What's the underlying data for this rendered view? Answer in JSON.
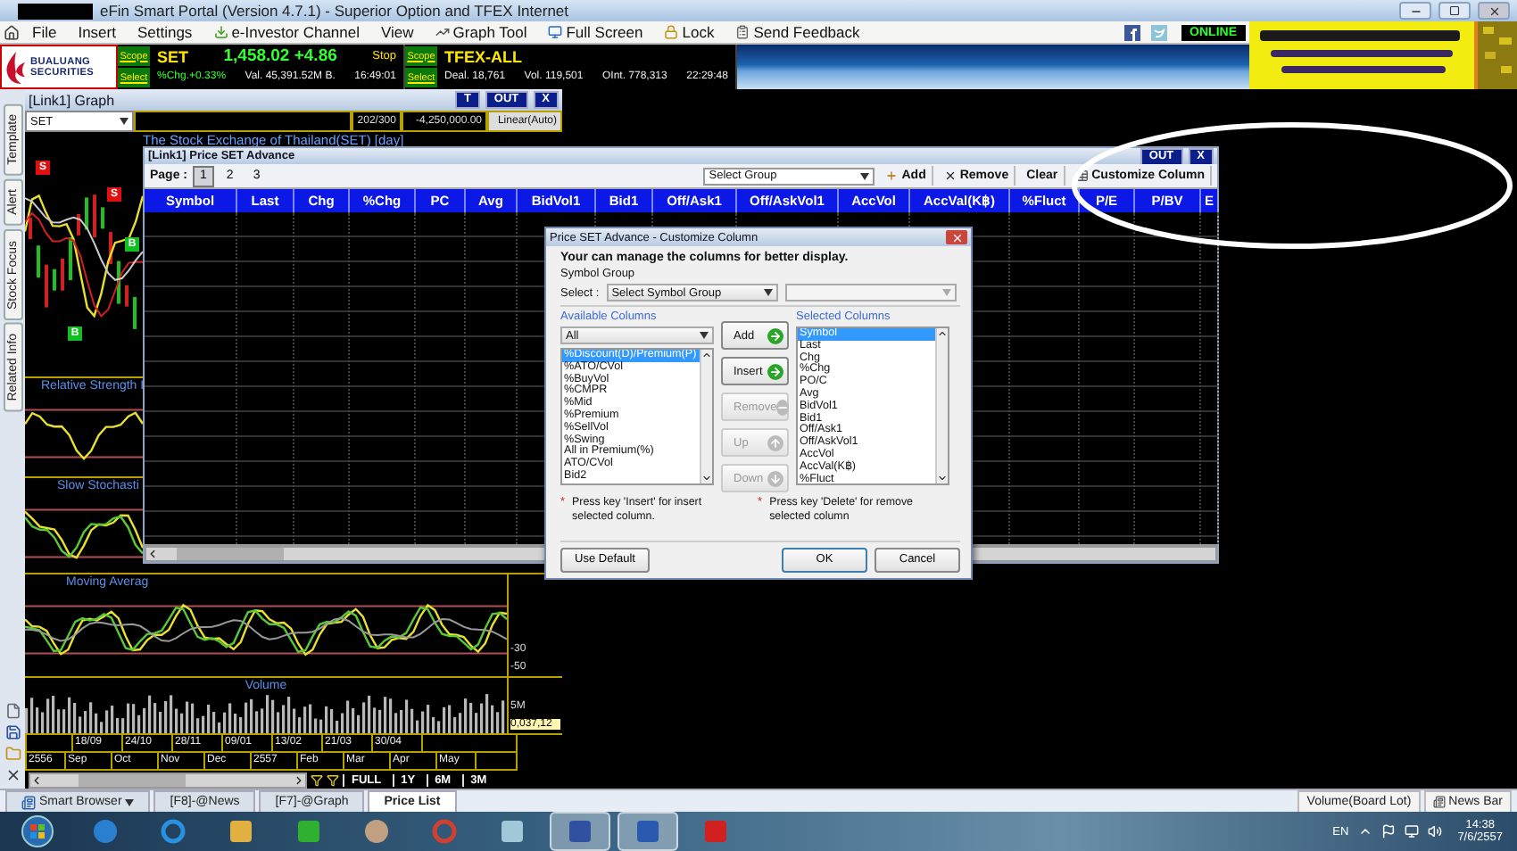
{
  "window": {
    "title": "eFin Smart Portal (Version 4.7.1) - Superior Option and TFEX Internet"
  },
  "menu": [
    {
      "label": "File",
      "kind": "text"
    },
    {
      "label": "Insert",
      "kind": "text"
    },
    {
      "label": "Settings",
      "kind": "text"
    },
    {
      "label": "e-Investor Channel",
      "kind": "channel"
    },
    {
      "label": "View",
      "kind": "text"
    },
    {
      "label": "Graph Tool",
      "kind": "graph"
    },
    {
      "label": "Full Screen",
      "kind": "screen"
    },
    {
      "label": "Lock",
      "kind": "lock"
    },
    {
      "label": "Send Feedback",
      "kind": "feedback"
    }
  ],
  "connection": {
    "label": "ONLINE",
    "online": true
  },
  "logo": {
    "line_1": "BUALUANG",
    "line_2": "SECURITIES"
  },
  "quotes": [
    {
      "kind": "index",
      "scope": "Scope",
      "select": "Select",
      "name": "SET",
      "price": "1,458.02 +4.86",
      "flag": "Stop",
      "details": [
        "%Chg.+0.33%",
        "Val. 45,391.52M B.",
        "16:49:01"
      ]
    },
    {
      "kind": "futures",
      "scope": "Scope",
      "select": "Select",
      "name": "TFEX-ALL",
      "details": [
        "Deal. 18,761",
        "Vol. 119,501",
        "OInt. 778,313",
        "22:29:48"
      ]
    }
  ],
  "side_tabs": [
    "Template",
    "Alert",
    "Stock Focus",
    "Related Info"
  ],
  "graph_window": {
    "title": "[Link1] Graph",
    "buttons": [
      "T",
      "OUT",
      "X"
    ],
    "symbol": "SET",
    "readouts": [
      "202/300",
      "-4,250,000.00",
      "Linear(Auto)"
    ],
    "chart_title": "The Stock Exchange of Thailand(SET) [day]",
    "signals": [
      {
        "label": "S",
        "kind": "sell"
      },
      {
        "label": "S",
        "kind": "sell"
      },
      {
        "label": "B",
        "kind": "buy"
      },
      {
        "label": "B",
        "kind": "buy"
      }
    ],
    "panels": [
      {
        "kind": "rsi",
        "label": "Relative Strength I"
      },
      {
        "kind": "stochastic",
        "label": "Slow Stochasti"
      },
      {
        "kind": "average",
        "label": "Moving Averag",
        "ticks": [
          "-30",
          "-50"
        ]
      },
      {
        "kind": "volume",
        "label": "Volume",
        "ticks": [
          "5M",
          "0,037,12"
        ]
      }
    ],
    "dates": [
      "18/09",
      "24/10",
      "28/11",
      "09/01",
      "13/02",
      "21/03",
      "30/04"
    ],
    "months": [
      "2556",
      "Sep",
      "Oct",
      "Nov",
      "Dec",
      "2557",
      "Feb",
      "Mar",
      "Apr",
      "May"
    ],
    "ranges": [
      "FULL",
      "1Y",
      "6M",
      "3M"
    ]
  },
  "price_window": {
    "title": "[Link1] Price SET Advance",
    "buttons": [
      "OUT",
      "X"
    ],
    "page_label": "Page :",
    "pages": [
      {
        "label": "1",
        "selected": true
      },
      {
        "label": "2",
        "selected": false
      },
      {
        "label": "3",
        "selected": false
      }
    ],
    "group": "Select Group",
    "tools": [
      {
        "label": "Add",
        "kind": "add"
      },
      {
        "label": "Remove",
        "kind": "remove"
      },
      {
        "label": "Clear",
        "kind": "clear"
      },
      {
        "label": "Customize Column",
        "kind": "customize"
      }
    ],
    "columns": [
      "Symbol",
      "Last",
      "Chg",
      "%Chg",
      "PC",
      "Avg",
      "BidVol1",
      "Bid1",
      "Off/Ask1",
      "Off/AskVol1",
      "AccVol",
      "AccVal(K฿)",
      "%Fluct",
      "P/E",
      "P/BV",
      "E"
    ]
  },
  "dialog": {
    "title": "Price SET Advance - Customize Column",
    "intro": "Your can manage the columns for better display.",
    "group_label": "Symbol Group",
    "select_label": "Select :",
    "select_value": "Select Symbol Group",
    "available_label": "Available Columns",
    "filter": "All",
    "available": [
      {
        "label": "%Discount(D)/Premium(P)",
        "selected": true
      },
      {
        "label": "%ATO/CVol",
        "selected": false
      },
      {
        "label": "%BuyVol",
        "selected": false
      },
      {
        "label": "%CMPR",
        "selected": false
      },
      {
        "label": "%Mid",
        "selected": false
      },
      {
        "label": "%Premium",
        "selected": false
      },
      {
        "label": "%SellVol",
        "selected": false
      },
      {
        "label": "%Swing",
        "selected": false
      },
      {
        "label": "All in Premium(%)",
        "selected": false
      },
      {
        "label": "ATO/CVol",
        "selected": false
      },
      {
        "label": "Bid2",
        "selected": false
      }
    ],
    "actions": [
      {
        "label": "Add",
        "kind": "add",
        "disabled": false
      },
      {
        "label": "Insert",
        "kind": "insert",
        "disabled": false
      },
      {
        "label": "Remove",
        "kind": "remove",
        "disabled": true
      },
      {
        "label": "Up",
        "kind": "up",
        "disabled": true
      },
      {
        "label": "Down",
        "kind": "down",
        "disabled": true
      }
    ],
    "selected_label": "Selected Columns",
    "selected_columns": [
      {
        "label": "Symbol",
        "selected": true
      },
      {
        "label": "Last",
        "selected": false
      },
      {
        "label": "Chg",
        "selected": false
      },
      {
        "label": "%Chg",
        "selected": false
      },
      {
        "label": "PO/C",
        "selected": false
      },
      {
        "label": "Avg",
        "selected": false
      },
      {
        "label": "BidVol1",
        "selected": false
      },
      {
        "label": "Bid1",
        "selected": false
      },
      {
        "label": "Off/Ask1",
        "selected": false
      },
      {
        "label": "Off/AskVol1",
        "selected": false
      },
      {
        "label": "AccVol",
        "selected": false
      },
      {
        "label": "AccVal(K฿)",
        "selected": false
      },
      {
        "label": "%Fluct",
        "selected": false
      }
    ],
    "notes": [
      {
        "mark": "*",
        "text": "Press key 'Insert' for insert selected column."
      },
      {
        "mark": "*",
        "text": "Press key 'Delete' for remove selected column"
      }
    ],
    "buttons": [
      "Use Default",
      "OK",
      "Cancel"
    ]
  },
  "bottom_tabs": [
    {
      "label": "Smart Browser",
      "kind": "browser",
      "selected": false
    },
    {
      "label": "[F8]-@News",
      "kind": "tab",
      "selected": false
    },
    {
      "label": "[F7]-@Graph",
      "kind": "tab",
      "selected": false
    },
    {
      "label": "Price List",
      "kind": "tab",
      "selected": true
    }
  ],
  "bottom_right": [
    "Volume(Board Lot)",
    "News Bar"
  ],
  "taskbar": {
    "language": "EN",
    "time": "14:38",
    "date": "7/6/2557"
  }
}
